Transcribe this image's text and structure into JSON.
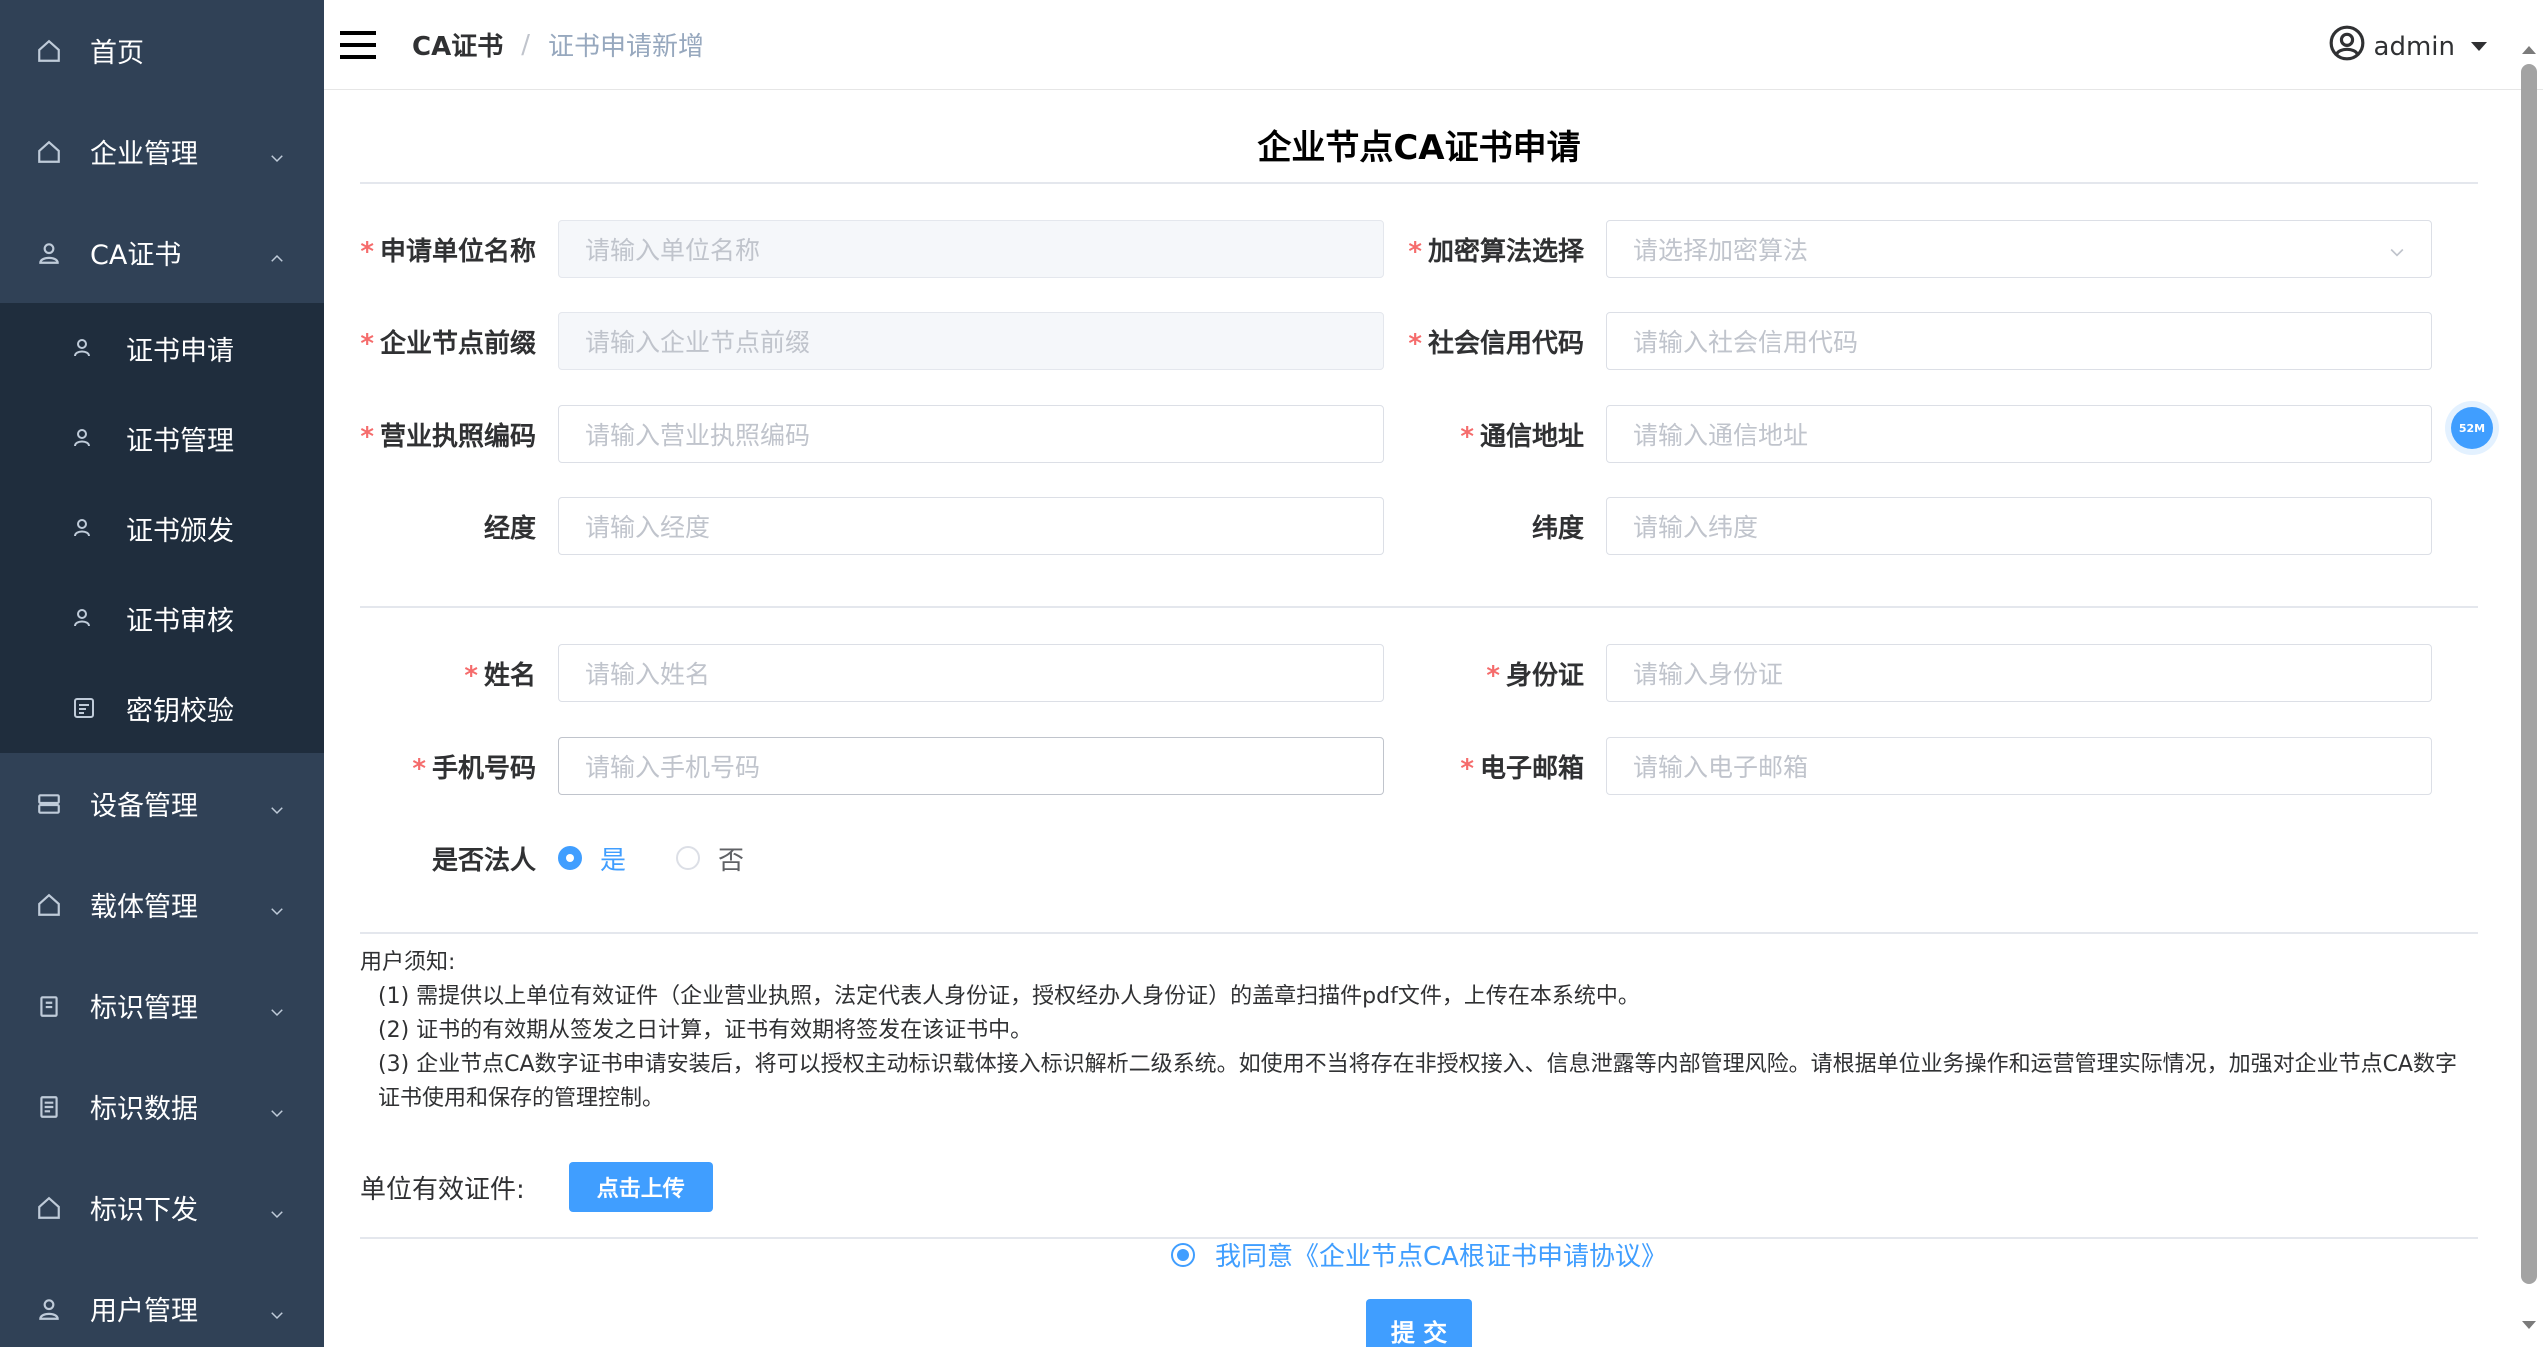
{
  "sidebar": {
    "items": [
      {
        "label": "首页"
      },
      {
        "label": "企业管理"
      },
      {
        "label": "CA证书"
      },
      {
        "label": "设备管理"
      },
      {
        "label": "载体管理"
      },
      {
        "label": "标识管理"
      },
      {
        "label": "标识数据"
      },
      {
        "label": "标识下发"
      },
      {
        "label": "用户管理"
      }
    ],
    "ca_submenu": [
      {
        "label": "证书申请"
      },
      {
        "label": "证书管理"
      },
      {
        "label": "证书颁发"
      },
      {
        "label": "证书审核"
      },
      {
        "label": "密钥校验"
      }
    ]
  },
  "header": {
    "breadcrumb_1": "CA证书",
    "breadcrumb_sep": "/",
    "breadcrumb_2": "证书申请新增",
    "username": "admin"
  },
  "form": {
    "title": "企业节点CA证书申请",
    "required_mark": "*",
    "fields": {
      "unit_name": {
        "label": "申请单位名称",
        "placeholder": "请输入单位名称"
      },
      "algorithm": {
        "label": "加密算法选择",
        "placeholder": "请选择加密算法"
      },
      "node_prefix": {
        "label": "企业节点前缀",
        "placeholder": "请输入企业节点前缀"
      },
      "credit_code": {
        "label": "社会信用代码",
        "placeholder": "请输入社会信用代码"
      },
      "license_code": {
        "label": "营业执照编码",
        "placeholder": "请输入营业执照编码"
      },
      "address": {
        "label": "通信地址",
        "placeholder": "请输入通信地址"
      },
      "longitude": {
        "label": "经度",
        "placeholder": "请输入经度"
      },
      "latitude": {
        "label": "纬度",
        "placeholder": "请输入纬度"
      },
      "name": {
        "label": "姓名",
        "placeholder": "请输入姓名"
      },
      "id_card": {
        "label": "身份证",
        "placeholder": "请输入身份证"
      },
      "phone": {
        "label": "手机号码",
        "placeholder": "请输入手机号码"
      },
      "email": {
        "label": "电子邮箱",
        "placeholder": "请输入电子邮箱"
      }
    },
    "legal_person": {
      "label": "是否法人",
      "options": [
        "是",
        "否"
      ],
      "selected": "是"
    }
  },
  "notice": {
    "heading": "用户须知:",
    "line1": "(1) 需提供以上单位有效证件（企业营业执照，法定代表人身份证，授权经办人身份证）的盖章扫描件pdf文件，上传在本系统中。",
    "line2": "(2) 证书的有效期从签发之日计算，证书有效期将签发在该证书中。",
    "line3": "(3) 企业节点CA数字证书申请安装后，将可以授权主动标识载体接入标识解析二级系统。如使用不当将存在非授权接入、信息泄露等内部管理风险。请根据单位业务操作和运营管理实际情况，加强对企业节点CA数字证书使用和保存的管理控制。"
  },
  "upload": {
    "label": "单位有效证件:",
    "button": "点击上传"
  },
  "agreement": "我同意《企业节点CA根证书申请协议》",
  "submit_label": "提 交",
  "float_badge": "52M",
  "colors": {
    "sidebar_bg": "#304156",
    "submenu_bg": "#1f2d3d",
    "primary": "#409eff",
    "required": "#f56c6c"
  }
}
